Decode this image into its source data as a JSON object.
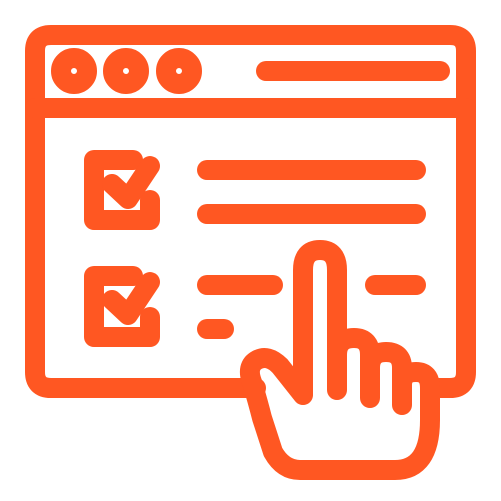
{
  "icon": {
    "name": "checklist-click-icon",
    "stroke_color": "#FF5722",
    "background": "#FFFFFF"
  },
  "window": {
    "control_dots": 3,
    "title_bar": "title-bar-line"
  },
  "checklist": {
    "items": [
      {
        "checked": true,
        "text_lines": 2
      },
      {
        "checked": true,
        "text_lines": 2
      }
    ]
  },
  "cursor": {
    "type": "pointing-hand-icon"
  }
}
